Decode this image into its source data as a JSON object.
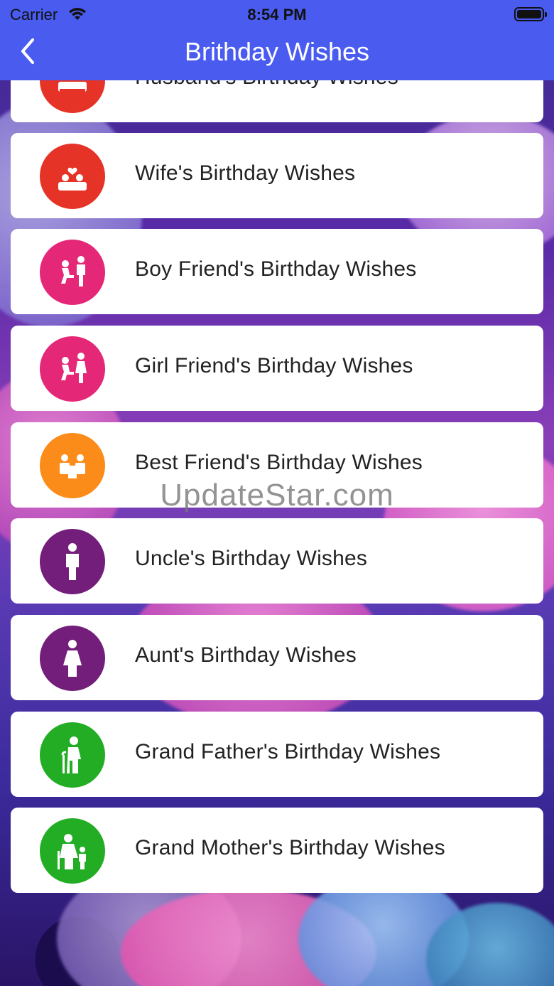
{
  "status_bar": {
    "carrier": "Carrier",
    "time": "8:54 PM"
  },
  "nav": {
    "title": "Brithday Wishes"
  },
  "items": [
    {
      "label": "Husband's Birthday Wishes",
      "color": "#e63328",
      "icon": "couple-icon"
    },
    {
      "label": "Wife's Birthday Wishes",
      "color": "#e63328",
      "icon": "couple-icon"
    },
    {
      "label": "Boy Friend's Birthday Wishes",
      "color": "#e42877",
      "icon": "proposal-icon"
    },
    {
      "label": "Girl Friend's Birthday Wishes",
      "color": "#e42877",
      "icon": "proposal-icon"
    },
    {
      "label": "Best Friend's Birthday Wishes",
      "color": "#fb8c1a",
      "icon": "friends-icon"
    },
    {
      "label": "Uncle's Birthday Wishes",
      "color": "#731e7a",
      "icon": "man-icon"
    },
    {
      "label": "Aunt's Birthday Wishes",
      "color": "#731e7a",
      "icon": "woman-icon"
    },
    {
      "label": "Grand Father's Birthday Wishes",
      "color": "#22ad24",
      "icon": "elderly-man-icon"
    },
    {
      "label": "Grand Mother's Birthday Wishes",
      "color": "#22ad24",
      "icon": "family-icon"
    }
  ],
  "watermark": "UpdateStar.com"
}
